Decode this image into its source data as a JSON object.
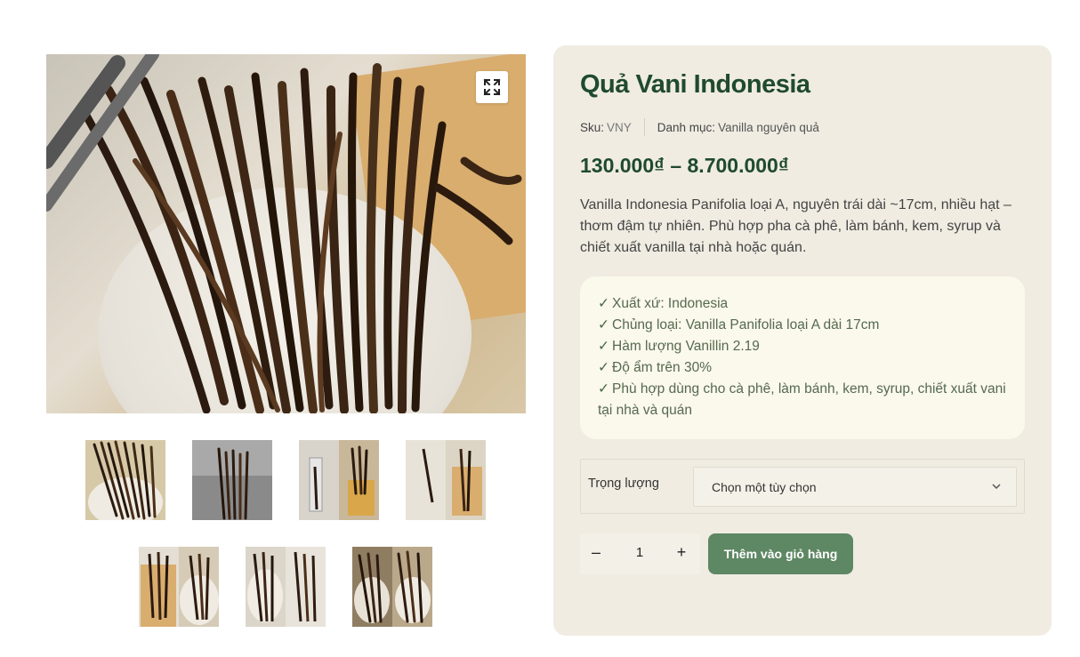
{
  "product": {
    "title": "Quả Vani Indonesia",
    "sku_label": "Sku:",
    "sku_value": "VNY",
    "category_label": "Danh mục:",
    "category_value": "Vanilla nguyên quả",
    "price": "130.000₫ – 8.700.000₫",
    "description": "Vanilla Indonesia Panifolia loại A, nguyên trái dài ~17cm, nhiều hạt – thơm đậm tự nhiên. Phù hợp pha cà phê, làm bánh, kem, syrup và chiết xuất vanilla tại nhà hoặc quán.",
    "features": [
      "Xuất xứ: Indonesia",
      "Chủng loại: Vanilla Panifolia loại A dài 17cm",
      "Hàm lượng Vanillin 2.19",
      "Độ ẩm trên 30%",
      "Phù hợp dùng cho cà phê, làm bánh, kem, syrup, chiết xuất vani tại nhà và quán"
    ],
    "check_mark": "✓"
  },
  "variation": {
    "label": "Trọng lượng",
    "select_value": "Chọn một tùy chọn"
  },
  "cart": {
    "minus": "–",
    "quantity": "1",
    "plus": "+",
    "add_label": "Thêm vào giỏ hàng"
  },
  "gallery": {
    "zoom_icon": "expand-icon",
    "thumbnail_count": 7
  },
  "colors": {
    "brand_green": "#1f4a2e",
    "button_green": "#5e8764",
    "card_bg": "#f0ece2",
    "features_bg": "#fbf8ec"
  }
}
